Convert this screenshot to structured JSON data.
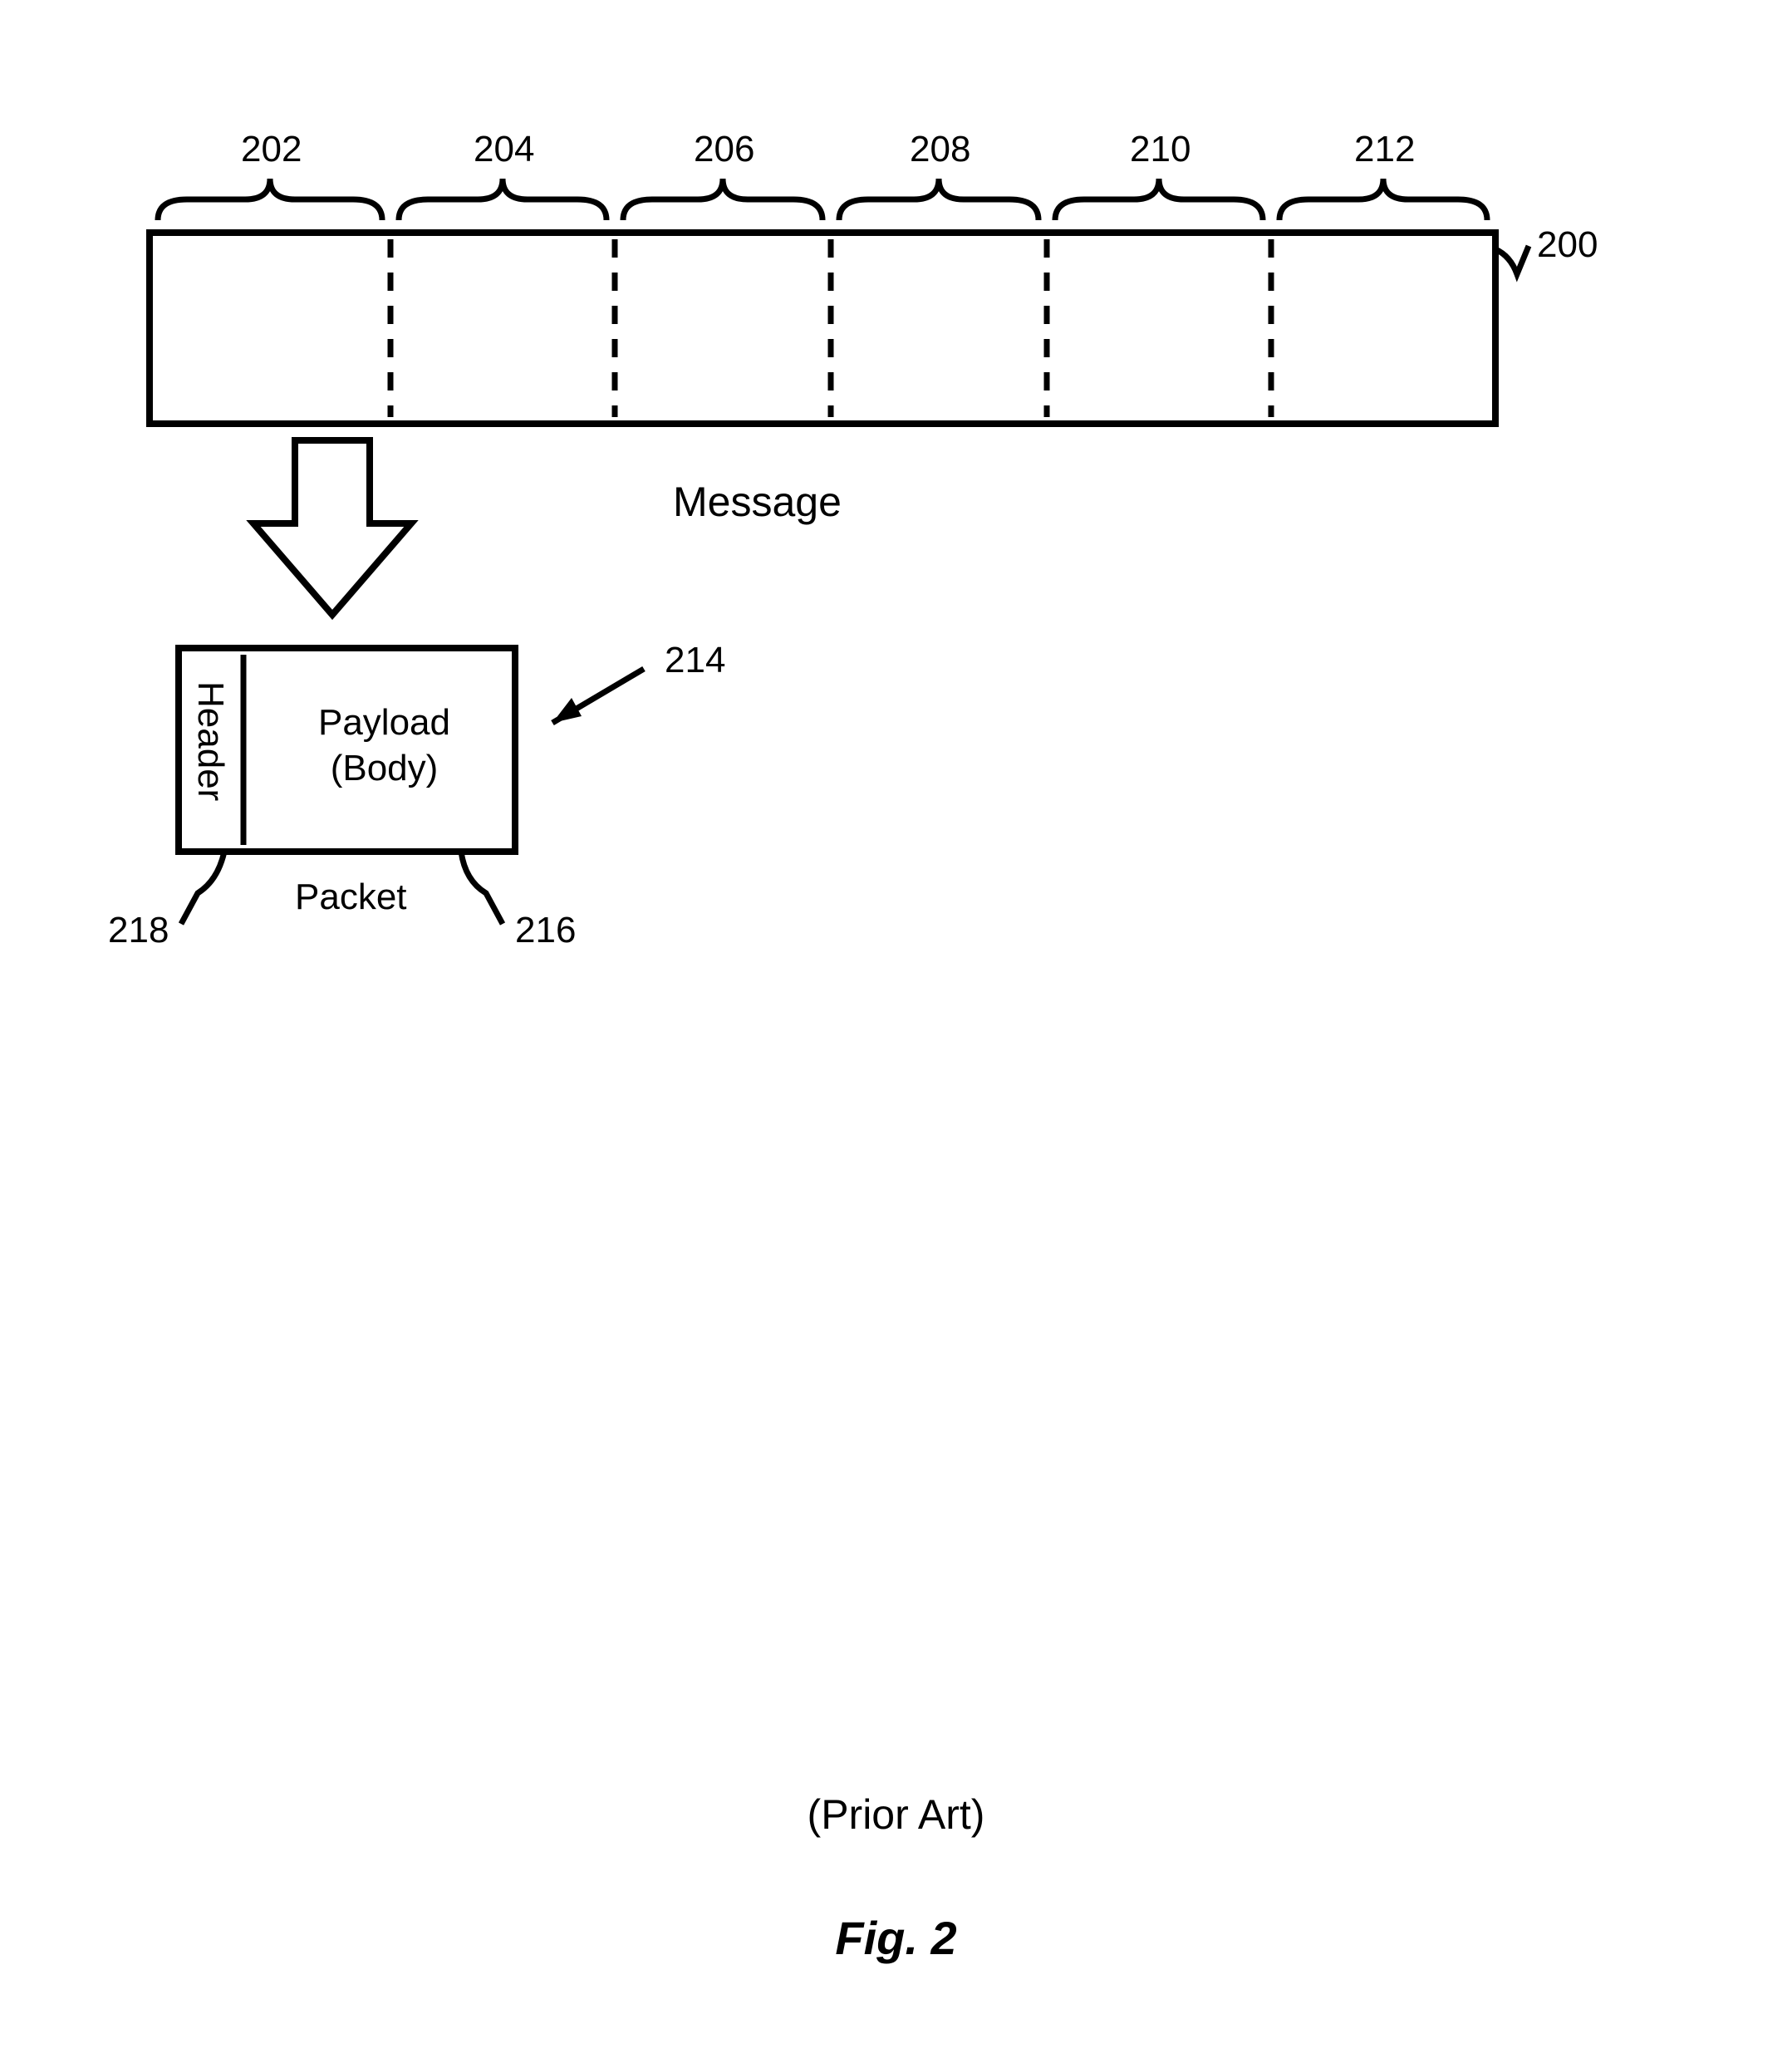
{
  "segments": {
    "s202": "202",
    "s204": "204",
    "s206": "206",
    "s208": "208",
    "s210": "210",
    "s212": "212"
  },
  "refs": {
    "r200": "200",
    "r214": "214",
    "r216": "216",
    "r218": "218"
  },
  "labels": {
    "message": "Message",
    "header": "Header",
    "payload_line1": "Payload",
    "payload_line2": "(Body)",
    "packet": "Packet",
    "prior_art": "(Prior Art)",
    "figure": "Fig. 2"
  }
}
